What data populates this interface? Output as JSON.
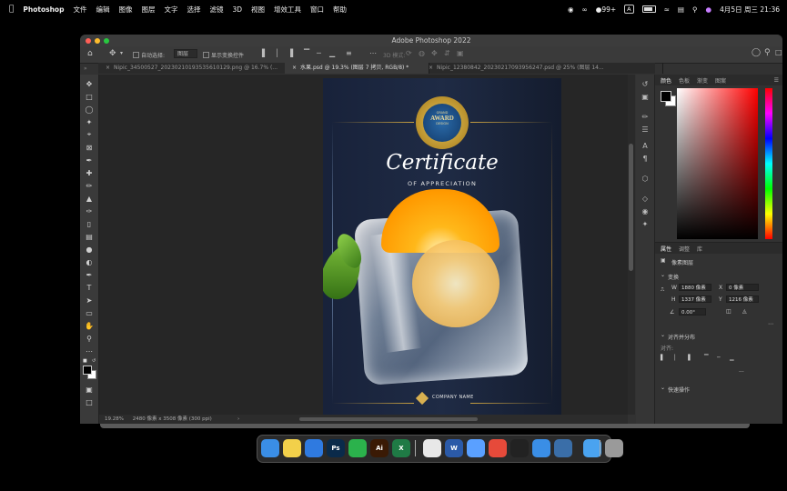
{
  "menubar": {
    "apple": "",
    "app_name": "Photoshop",
    "items": [
      "文件",
      "编辑",
      "图像",
      "图层",
      "文字",
      "选择",
      "滤镜",
      "3D",
      "视图",
      "增效工具",
      "窗口",
      "帮助"
    ],
    "notification_count": "99+",
    "input_method": "A",
    "date_time": "4月5日 周三  21:36"
  },
  "window": {
    "title": "Adobe Photoshop 2022",
    "options": {
      "auto_select_label": "自动选择:",
      "auto_select_value": "图层",
      "transform_controls_label": "显示变换控件",
      "mode_3d": "3D 模式:"
    },
    "tabs": [
      {
        "label": "Nipic_34500527_20230210193535610129.png @ 16.7% (..."
      },
      {
        "label": "水果.psd @ 19.3% (图层 7 拷贝, RGB/8) *"
      },
      {
        "label": "Nipic_12380842_20230217093956247.psd @ 25% (图层 14..."
      }
    ],
    "status": {
      "zoom": "19.28%",
      "dimensions": "2480 像素 x 3508 像素 (300 ppi)"
    }
  },
  "document": {
    "seal_top": "GRAND",
    "seal_main": "AWARD",
    "seal_bottom": "DESIGN",
    "title": "Certificate",
    "subtitle": "OF APPRECIATION",
    "company": "COMPANY NAME"
  },
  "panels": {
    "color_tabs": [
      "颜色",
      "色板",
      "渐变",
      "图案"
    ],
    "props_tabs": [
      "属性",
      "调整",
      "库"
    ],
    "pixel_layer": "像素图层",
    "transform_header": "变换",
    "w_label": "W",
    "w_value": "1880 像素",
    "x_label": "X",
    "x_value": "0 像素",
    "h_label": "H",
    "h_value": "1337 像素",
    "y_label": "Y",
    "y_value": "1216 像素",
    "angle_value": "0.00°",
    "align_header": "对齐并分布",
    "align_label": "对齐:",
    "quick_actions": "快速操作",
    "more": "..."
  },
  "colors": {
    "hue_marker": "#ff0000",
    "accent": "#3b8cff",
    "gold": "#c8a040"
  },
  "dock": [
    {
      "icon": "finder-icon",
      "color": "#3a8ee6"
    },
    {
      "icon": "notes-icon",
      "color": "#f2d04a"
    },
    {
      "icon": "safari-icon",
      "color": "#2f7ae0"
    },
    {
      "icon": "photoshop-icon",
      "color": "#0a2a4a",
      "text": "Ps"
    },
    {
      "icon": "wechat-icon",
      "color": "#2bb24c"
    },
    {
      "icon": "illustrator-icon",
      "color": "#3a1a05",
      "text": "Ai"
    },
    {
      "icon": "excel-icon",
      "color": "#1f7a45",
      "text": "X"
    },
    {
      "icon": "chrome-icon",
      "color": "#e8e8e8"
    },
    {
      "icon": "word-icon",
      "color": "#2b5aa8",
      "text": "W"
    },
    {
      "icon": "app-store-icon",
      "color": "#5aa0ff"
    },
    {
      "icon": "wps-icon",
      "color": "#e64a3a"
    },
    {
      "icon": "qq-icon",
      "color": "#222"
    },
    {
      "icon": "baidu-netdisk-icon",
      "color": "#3a8ee6"
    },
    {
      "icon": "quicktime-icon",
      "color": "#3a6ea8"
    },
    {
      "icon": "folder-icon",
      "color": "#4aa3f0"
    },
    {
      "icon": "trash-icon",
      "color": "#9a9a9a"
    }
  ]
}
